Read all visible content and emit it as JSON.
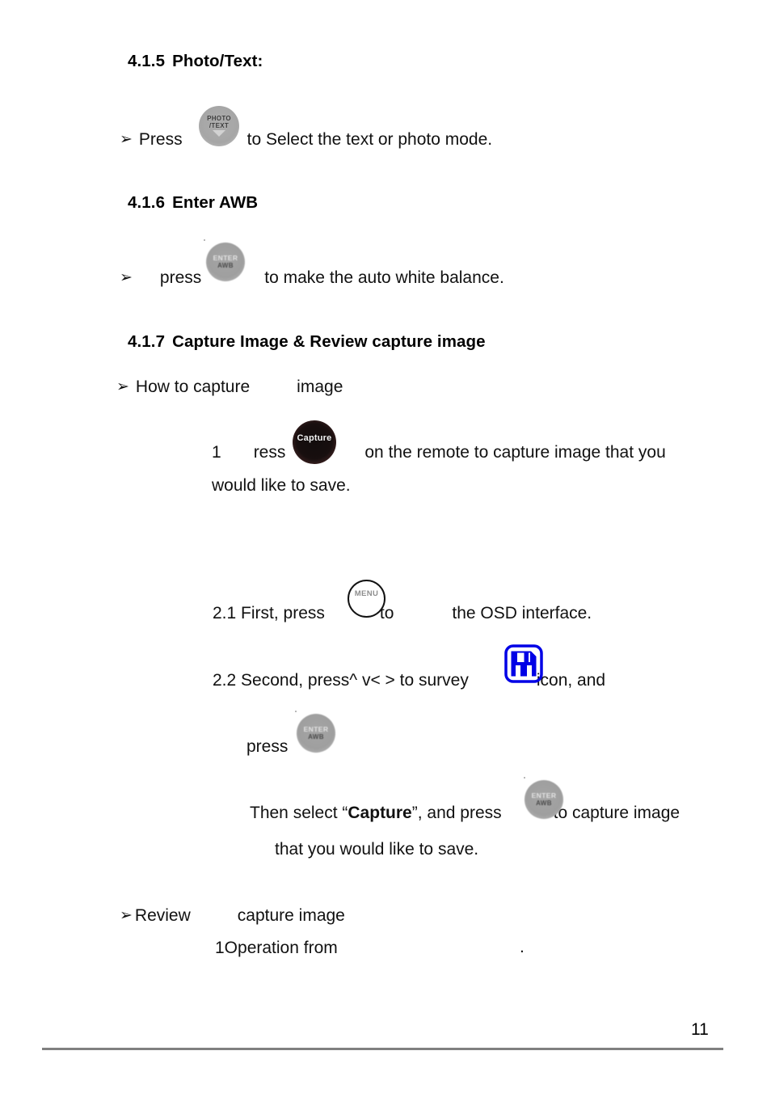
{
  "document": {
    "page_number": "11"
  },
  "sections": {
    "photo_text": {
      "number": "4.1.5",
      "title": "Photo/Text:",
      "bullet": "➢",
      "line_before": "Press",
      "line_after": "to Select the text or photo mode.",
      "button": {
        "name": "photo-text-button",
        "label_line1": "PHOTO",
        "label_line2": "/TEXT",
        "glyph": "chevron-down"
      }
    },
    "enter_awb": {
      "number": "4.1.6",
      "title": "Enter AWB",
      "bullet": "➢",
      "line_before": "press",
      "line_after": "to make the auto white balance.",
      "button": {
        "name": "enter-awb-button",
        "label_line1": "ENTER",
        "label_line2": "AWB"
      }
    },
    "capture_review": {
      "number": "4.1.7",
      "title": "Capture Image & Review capture image",
      "how_to": {
        "bullet": "➢",
        "text_a": "How to capture",
        "text_b": "image"
      },
      "step1": {
        "index": "1",
        "before": "ress",
        "after": "on the remote to capture image that you",
        "continuation": "would like to save.",
        "button": {
          "name": "capture-button",
          "label": "Capture"
        }
      },
      "step2_1": {
        "before": "2.1 First, press",
        "middle": "to",
        "after": "the OSD interface.",
        "button": {
          "name": "menu-button",
          "label": "MENU"
        }
      },
      "step2_2": {
        "before": "2.2 Second, press^ v< > to survey",
        "after": "icon, and",
        "icon": {
          "name": "save-icon",
          "color": "#0000e6"
        }
      },
      "step2_3": {
        "text": "press",
        "button": {
          "name": "enter-awb-button",
          "label_line1": "ENTER",
          "label_line2": "AWB"
        }
      },
      "step2_4": {
        "before": "Then select “",
        "emphasis": "Capture",
        "middle": "”, and press",
        "after": "to capture image",
        "continuation": "that you would like to save.",
        "button": {
          "name": "enter-awb-button",
          "label_line1": "ENTER",
          "label_line2": "AWB"
        }
      },
      "review": {
        "bullet": "➢",
        "text_a": "Review",
        "text_b": "capture image",
        "sub_line": "1Operation from",
        "trailing": "."
      }
    }
  },
  "colors": {
    "text": "#111111",
    "rule": "#808080",
    "save_icon_blue": "#0000e6",
    "button_grey": "#a5a5a5",
    "capture_dark": "#120c0c"
  }
}
